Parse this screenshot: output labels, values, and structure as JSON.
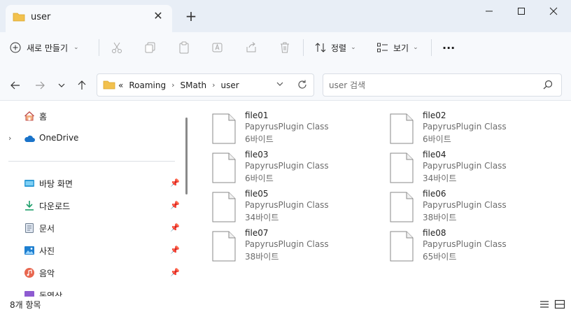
{
  "window": {
    "tab_title": "user",
    "tab_close": "✕",
    "new_tab": "+"
  },
  "toolbar": {
    "new_label": "새로 만들기",
    "sort_label": "정렬",
    "view_label": "보기",
    "more": "···"
  },
  "address": {
    "overflow": "«",
    "crumbs": [
      "Roaming",
      "SMath",
      "user"
    ],
    "sep": "›"
  },
  "search": {
    "placeholder": "user 검색"
  },
  "nav": {
    "home": "홈",
    "onedrive": "OneDrive",
    "quick": [
      {
        "label": "바탕 화면"
      },
      {
        "label": "다운로드"
      },
      {
        "label": "문서"
      },
      {
        "label": "사진"
      },
      {
        "label": "음악"
      },
      {
        "label": "동영상"
      }
    ]
  },
  "files": [
    {
      "name": "file01",
      "type": "PapyrusPlugin Class",
      "size": "6바이트"
    },
    {
      "name": "file02",
      "type": "PapyrusPlugin Class",
      "size": "6바이트"
    },
    {
      "name": "file03",
      "type": "PapyrusPlugin Class",
      "size": "6바이트"
    },
    {
      "name": "file04",
      "type": "PapyrusPlugin Class",
      "size": "34바이트"
    },
    {
      "name": "file05",
      "type": "PapyrusPlugin Class",
      "size": "34바이트"
    },
    {
      "name": "file06",
      "type": "PapyrusPlugin Class",
      "size": "38바이트"
    },
    {
      "name": "file07",
      "type": "PapyrusPlugin Class",
      "size": "38바이트"
    },
    {
      "name": "file08",
      "type": "PapyrusPlugin Class",
      "size": "65바이트"
    }
  ],
  "status": {
    "count": "8개 항목"
  },
  "colors": {
    "titlebar": "#e8eef6",
    "toolbar": "#f7f9fc",
    "folder": "#f2c14e",
    "accent": "#0067c0"
  }
}
